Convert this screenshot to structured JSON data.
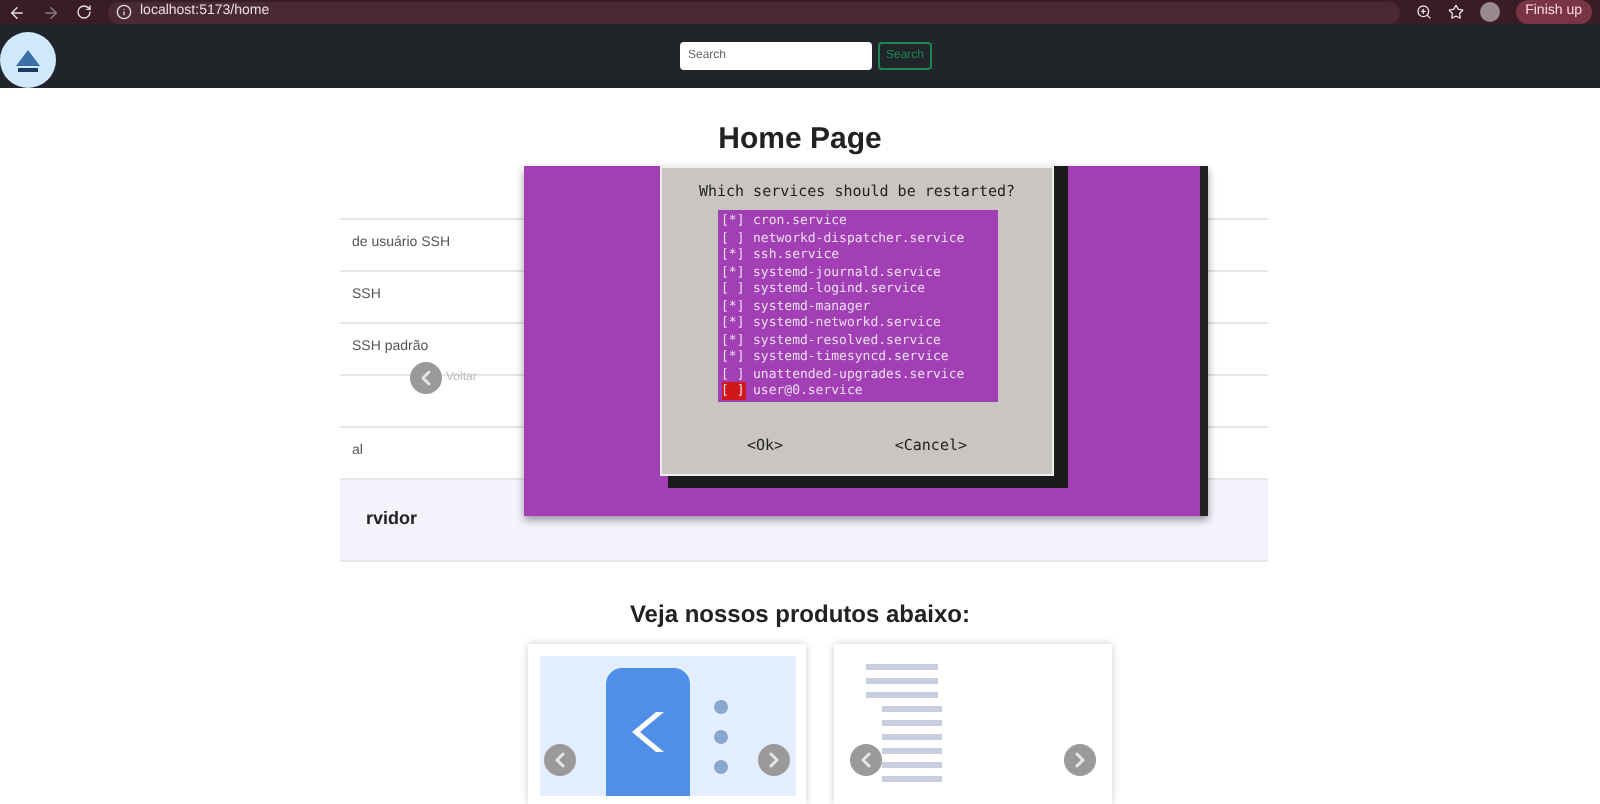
{
  "browser": {
    "url": "localhost:5173/home",
    "profile_button": "Finish up"
  },
  "navbar": {
    "search": {
      "placeholder": "Search"
    },
    "search_button": "Search"
  },
  "title": "Home Page",
  "list_items": [
    "de usuário SSH",
    "SSH",
    "SSH padrão",
    "al"
  ],
  "section_heading": "rvidor",
  "carousel": {
    "previous": "Voltar",
    "terminal": {
      "prompt": "Which services should be restarted?",
      "checkbox_marks": {
        "on": "[*]",
        "off": "[ ]"
      },
      "services": [
        {
          "name": "cron.service",
          "checked": true,
          "selected": false
        },
        {
          "name": "networkd-dispatcher.service",
          "checked": false,
          "selected": false
        },
        {
          "name": "ssh.service",
          "checked": true,
          "selected": false
        },
        {
          "name": "systemd-journald.service",
          "checked": true,
          "selected": false
        },
        {
          "name": "systemd-logind.service",
          "checked": false,
          "selected": false
        },
        {
          "name": "systemd-manager",
          "checked": true,
          "selected": false
        },
        {
          "name": "systemd-networkd.service",
          "checked": true,
          "selected": false
        },
        {
          "name": "systemd-resolved.service",
          "checked": true,
          "selected": false
        },
        {
          "name": "systemd-timesyncd.service",
          "checked": true,
          "selected": false
        },
        {
          "name": "unattended-upgrades.service",
          "checked": false,
          "selected": false
        },
        {
          "name": "user@0.service",
          "checked": false,
          "selected": true
        }
      ],
      "buttons": [
        "<Ok>",
        "<Cancel>"
      ]
    }
  },
  "products": {
    "heading": "Veja nossos produtos abaixo:",
    "cards": [
      {
        "kind": "phone"
      },
      {
        "kind": "tree"
      }
    ]
  }
}
